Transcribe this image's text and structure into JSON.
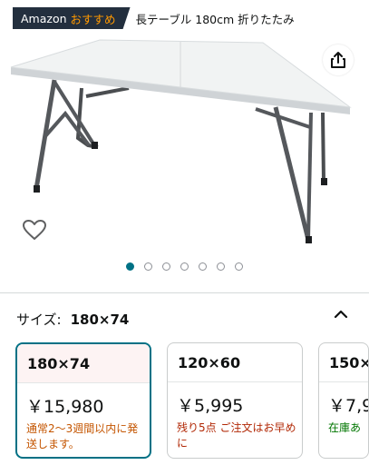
{
  "header": {
    "badge_brand": "Amazon",
    "badge_accent": "おすすめ",
    "product_title": "長テーブル 180cm 折りたたみ"
  },
  "gallery": {
    "image_count": 7,
    "active_index": 0
  },
  "size_selector": {
    "label": "サイズ:",
    "selected_value": "180×74",
    "options": [
      {
        "size": "180×74",
        "price": "￥15,980",
        "note": "通常2～3週間以内に発送します。",
        "selected": true
      },
      {
        "size": "120×60",
        "price": "￥5,995",
        "note": "残り5点 ご注文はお早めに",
        "selected": false
      },
      {
        "size": "150×",
        "price": "￥7,9",
        "note": "在庫あ",
        "selected": false
      }
    ]
  },
  "colors": {
    "accent": "#007185",
    "badge_bg": "#232f3e",
    "badge_accent": "#ff9900",
    "orange_note": "#c45500",
    "red_note": "#b12704",
    "green_note": "#007600"
  },
  "icons": {
    "share": "share-icon",
    "favorite": "heart-icon",
    "collapse": "chevron-up-icon"
  }
}
